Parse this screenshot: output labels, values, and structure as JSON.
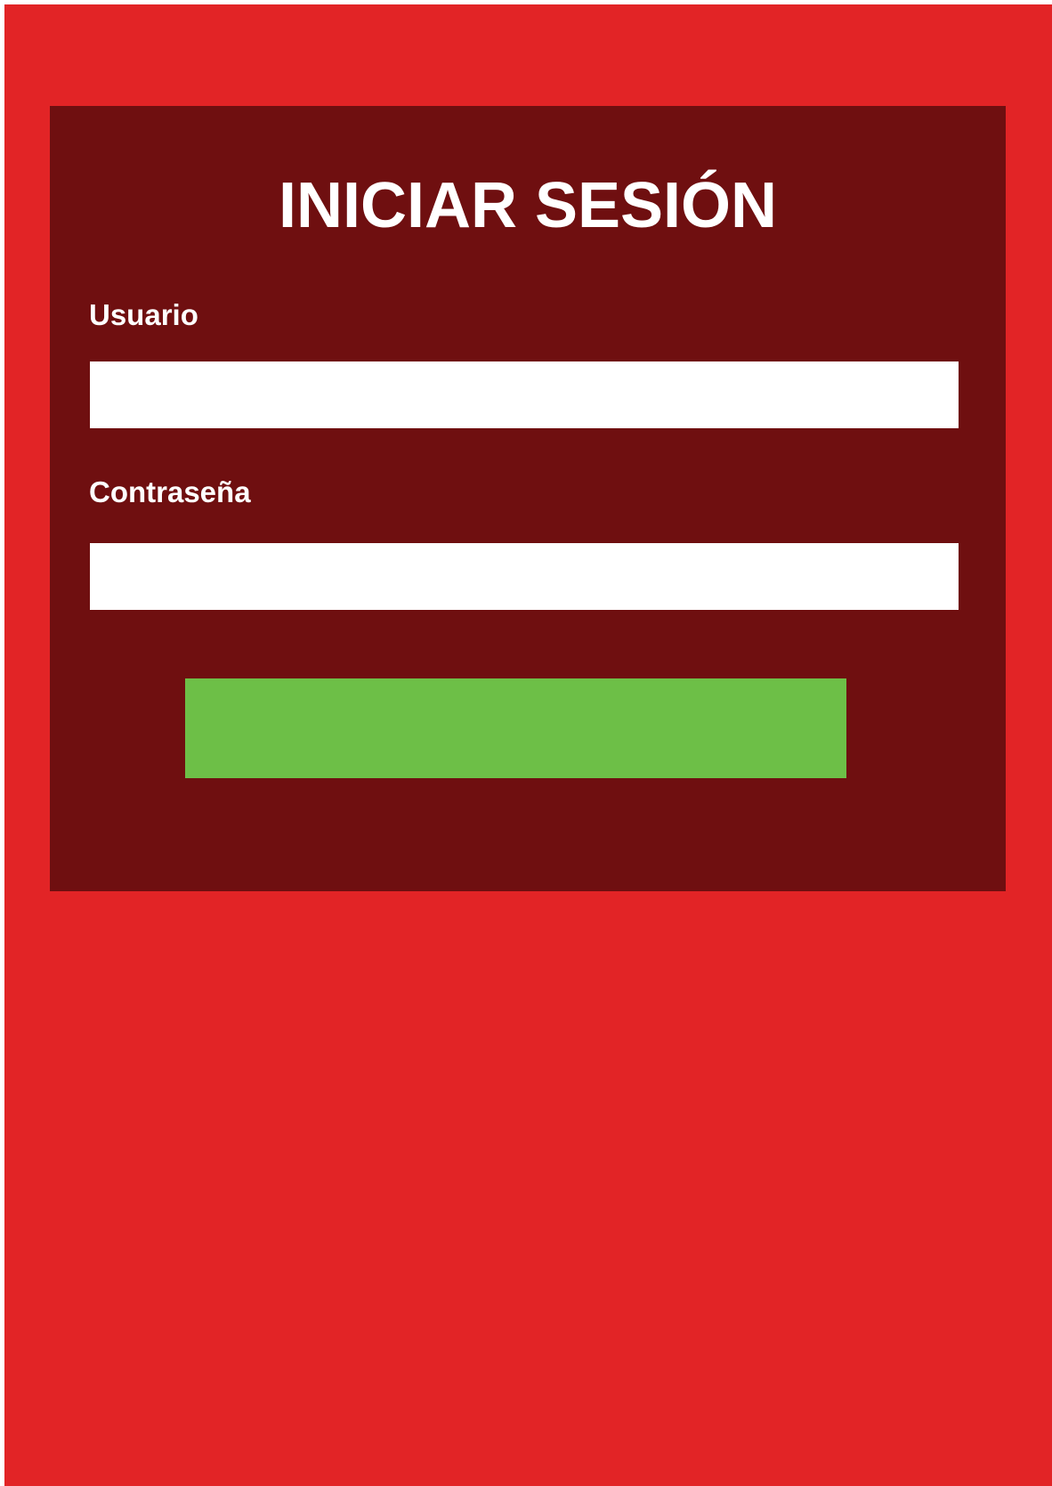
{
  "colors": {
    "background": "#e22426",
    "panel": "#6f0f10",
    "input_background": "#ffffff",
    "button": "#6dbf47",
    "text": "#ffffff"
  },
  "login": {
    "title": "INICIAR SESIÓN",
    "username": {
      "label": "Usuario",
      "value": "",
      "placeholder": ""
    },
    "password": {
      "label": "Contraseña",
      "value": "",
      "placeholder": ""
    },
    "submit_label": ""
  }
}
